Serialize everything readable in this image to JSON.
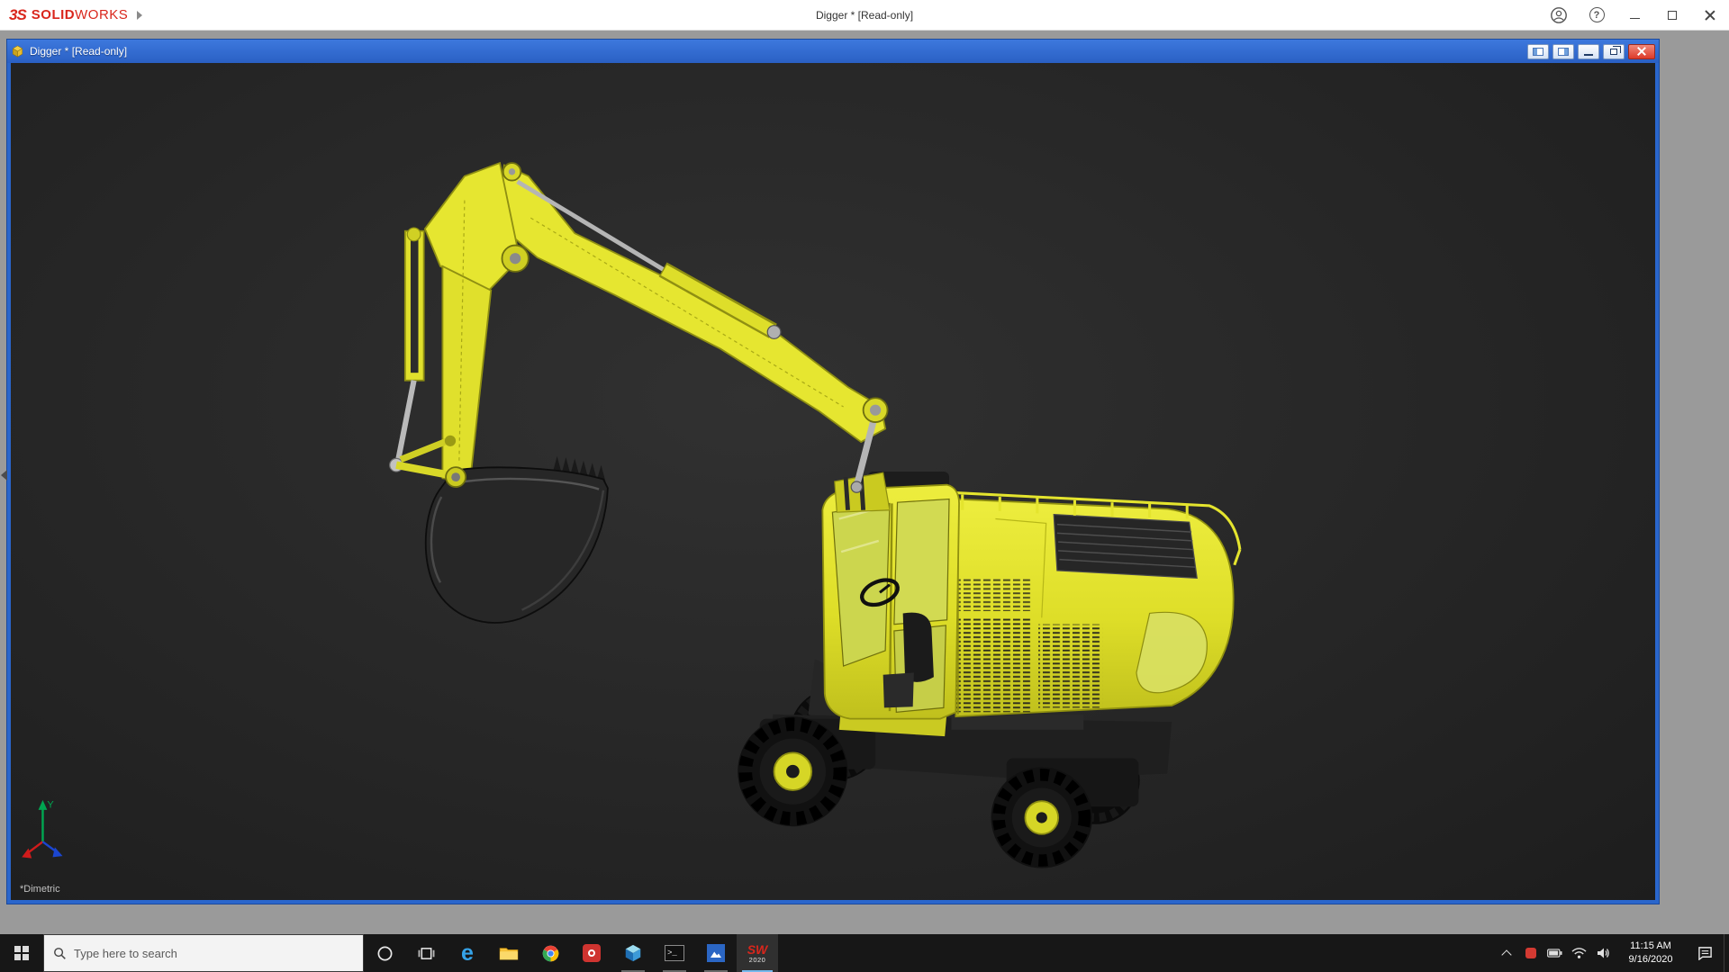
{
  "app_titlebar": {
    "logo_mark": "3S",
    "brand_bold": "SOLID",
    "brand_light": "WORKS",
    "title": "Digger * [Read-only]",
    "help_glyph": "?"
  },
  "doc_window": {
    "title": "Digger * [Read-only]"
  },
  "viewport": {
    "orientation_label": "*Dimetric",
    "triad_y": "Y"
  },
  "taskbar": {
    "search_placeholder": "Type here to search",
    "edge_glyph": "e",
    "terminal_glyph": ">_",
    "sw_mark": "SW",
    "sw_year": "2020"
  },
  "tray": {
    "time": "11:15 AM",
    "date": "9/16/2020"
  },
  "colors": {
    "solidworks_red": "#d9261c",
    "doc_titlebar_blue": "#2a66cc",
    "close_button_red": "#dc3a2a",
    "model_yellow": "#e6e630",
    "viewport_dark": "#262626",
    "taskbar_dark": "#171717"
  }
}
